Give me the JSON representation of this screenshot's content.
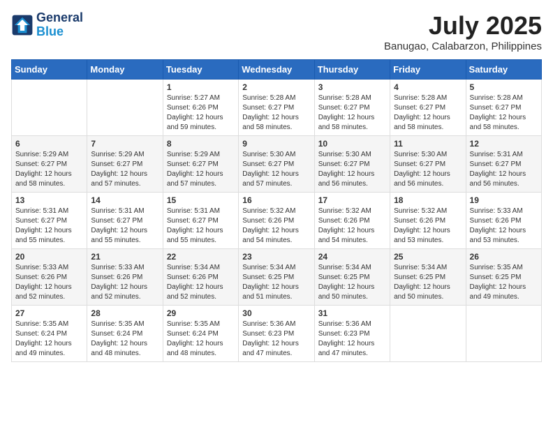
{
  "header": {
    "logo_line1": "General",
    "logo_line2": "Blue",
    "month_year": "July 2025",
    "location": "Banugao, Calabarzon, Philippines"
  },
  "weekdays": [
    "Sunday",
    "Monday",
    "Tuesday",
    "Wednesday",
    "Thursday",
    "Friday",
    "Saturday"
  ],
  "weeks": [
    [
      {
        "day": "",
        "info": ""
      },
      {
        "day": "",
        "info": ""
      },
      {
        "day": "1",
        "info": "Sunrise: 5:27 AM\nSunset: 6:26 PM\nDaylight: 12 hours and 59 minutes."
      },
      {
        "day": "2",
        "info": "Sunrise: 5:28 AM\nSunset: 6:27 PM\nDaylight: 12 hours and 58 minutes."
      },
      {
        "day": "3",
        "info": "Sunrise: 5:28 AM\nSunset: 6:27 PM\nDaylight: 12 hours and 58 minutes."
      },
      {
        "day": "4",
        "info": "Sunrise: 5:28 AM\nSunset: 6:27 PM\nDaylight: 12 hours and 58 minutes."
      },
      {
        "day": "5",
        "info": "Sunrise: 5:28 AM\nSunset: 6:27 PM\nDaylight: 12 hours and 58 minutes."
      }
    ],
    [
      {
        "day": "6",
        "info": "Sunrise: 5:29 AM\nSunset: 6:27 PM\nDaylight: 12 hours and 58 minutes."
      },
      {
        "day": "7",
        "info": "Sunrise: 5:29 AM\nSunset: 6:27 PM\nDaylight: 12 hours and 57 minutes."
      },
      {
        "day": "8",
        "info": "Sunrise: 5:29 AM\nSunset: 6:27 PM\nDaylight: 12 hours and 57 minutes."
      },
      {
        "day": "9",
        "info": "Sunrise: 5:30 AM\nSunset: 6:27 PM\nDaylight: 12 hours and 57 minutes."
      },
      {
        "day": "10",
        "info": "Sunrise: 5:30 AM\nSunset: 6:27 PM\nDaylight: 12 hours and 56 minutes."
      },
      {
        "day": "11",
        "info": "Sunrise: 5:30 AM\nSunset: 6:27 PM\nDaylight: 12 hours and 56 minutes."
      },
      {
        "day": "12",
        "info": "Sunrise: 5:31 AM\nSunset: 6:27 PM\nDaylight: 12 hours and 56 minutes."
      }
    ],
    [
      {
        "day": "13",
        "info": "Sunrise: 5:31 AM\nSunset: 6:27 PM\nDaylight: 12 hours and 55 minutes."
      },
      {
        "day": "14",
        "info": "Sunrise: 5:31 AM\nSunset: 6:27 PM\nDaylight: 12 hours and 55 minutes."
      },
      {
        "day": "15",
        "info": "Sunrise: 5:31 AM\nSunset: 6:27 PM\nDaylight: 12 hours and 55 minutes."
      },
      {
        "day": "16",
        "info": "Sunrise: 5:32 AM\nSunset: 6:26 PM\nDaylight: 12 hours and 54 minutes."
      },
      {
        "day": "17",
        "info": "Sunrise: 5:32 AM\nSunset: 6:26 PM\nDaylight: 12 hours and 54 minutes."
      },
      {
        "day": "18",
        "info": "Sunrise: 5:32 AM\nSunset: 6:26 PM\nDaylight: 12 hours and 53 minutes."
      },
      {
        "day": "19",
        "info": "Sunrise: 5:33 AM\nSunset: 6:26 PM\nDaylight: 12 hours and 53 minutes."
      }
    ],
    [
      {
        "day": "20",
        "info": "Sunrise: 5:33 AM\nSunset: 6:26 PM\nDaylight: 12 hours and 52 minutes."
      },
      {
        "day": "21",
        "info": "Sunrise: 5:33 AM\nSunset: 6:26 PM\nDaylight: 12 hours and 52 minutes."
      },
      {
        "day": "22",
        "info": "Sunrise: 5:34 AM\nSunset: 6:26 PM\nDaylight: 12 hours and 52 minutes."
      },
      {
        "day": "23",
        "info": "Sunrise: 5:34 AM\nSunset: 6:25 PM\nDaylight: 12 hours and 51 minutes."
      },
      {
        "day": "24",
        "info": "Sunrise: 5:34 AM\nSunset: 6:25 PM\nDaylight: 12 hours and 50 minutes."
      },
      {
        "day": "25",
        "info": "Sunrise: 5:34 AM\nSunset: 6:25 PM\nDaylight: 12 hours and 50 minutes."
      },
      {
        "day": "26",
        "info": "Sunrise: 5:35 AM\nSunset: 6:25 PM\nDaylight: 12 hours and 49 minutes."
      }
    ],
    [
      {
        "day": "27",
        "info": "Sunrise: 5:35 AM\nSunset: 6:24 PM\nDaylight: 12 hours and 49 minutes."
      },
      {
        "day": "28",
        "info": "Sunrise: 5:35 AM\nSunset: 6:24 PM\nDaylight: 12 hours and 48 minutes."
      },
      {
        "day": "29",
        "info": "Sunrise: 5:35 AM\nSunset: 6:24 PM\nDaylight: 12 hours and 48 minutes."
      },
      {
        "day": "30",
        "info": "Sunrise: 5:36 AM\nSunset: 6:23 PM\nDaylight: 12 hours and 47 minutes."
      },
      {
        "day": "31",
        "info": "Sunrise: 5:36 AM\nSunset: 6:23 PM\nDaylight: 12 hours and 47 minutes."
      },
      {
        "day": "",
        "info": ""
      },
      {
        "day": "",
        "info": ""
      }
    ]
  ]
}
